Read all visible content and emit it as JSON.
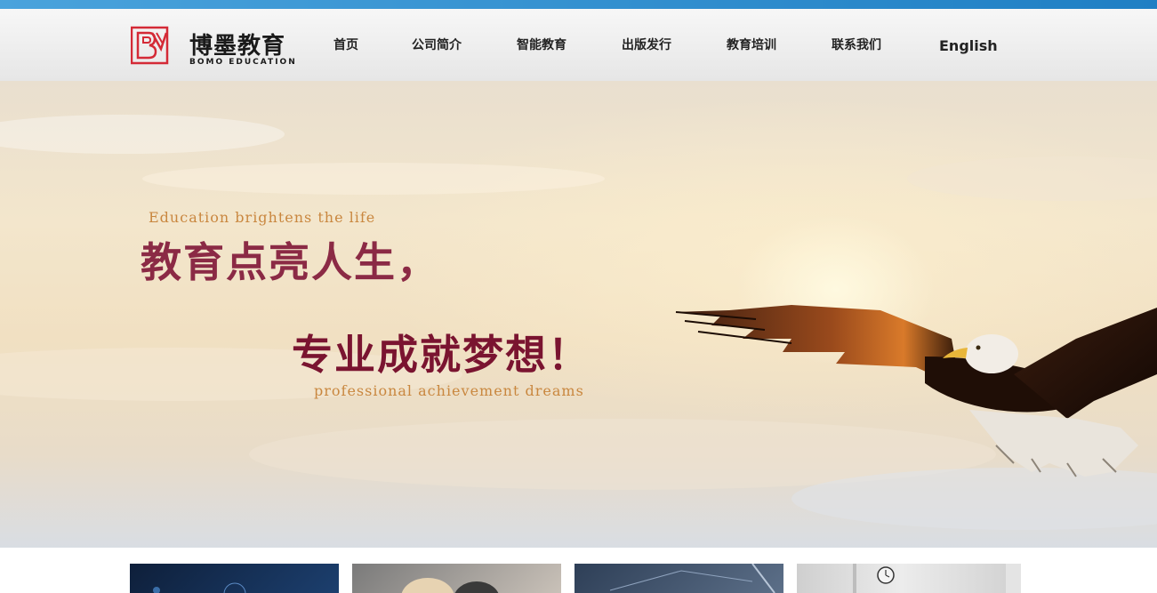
{
  "brand": {
    "name_cn": "博墨教育",
    "name_en": "BOMO EDUCATION",
    "colors": {
      "accent": "#d42a36",
      "topbar": "#1f7fc4"
    }
  },
  "nav": {
    "items": [
      {
        "label": "首页"
      },
      {
        "label": "公司简介"
      },
      {
        "label": "智能教育"
      },
      {
        "label": "出版发行"
      },
      {
        "label": "教育培训"
      },
      {
        "label": "联系我们"
      },
      {
        "label": "English"
      }
    ]
  },
  "hero": {
    "tagline_en_top": "Education brightens the life",
    "tagline_cn_line1": "教育点亮人生，",
    "tagline_cn_line2": "专业成就梦想！",
    "tagline_en_bottom": "professional achievement dreams",
    "image": "eagle-flying-at-sunset"
  },
  "cards": [
    {
      "image": "tech-blue-thumbnail"
    },
    {
      "image": "people-thumbnail"
    },
    {
      "image": "circuit-thumbnail"
    },
    {
      "image": "clock-thumbnail"
    }
  ]
}
